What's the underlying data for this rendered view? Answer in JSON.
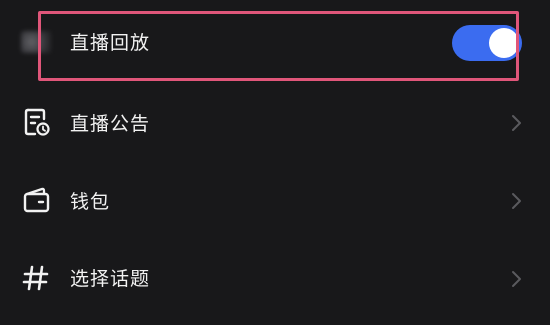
{
  "settings": {
    "items": [
      {
        "label": "直播回放",
        "icon": "avatar-icon",
        "control": "toggle",
        "on": true
      },
      {
        "label": "直播公告",
        "icon": "notice-icon",
        "control": "chevron"
      },
      {
        "label": "钱包",
        "icon": "wallet-icon",
        "control": "chevron"
      },
      {
        "label": "选择话题",
        "icon": "hashtag-icon",
        "control": "chevron"
      }
    ]
  },
  "colors": {
    "background": "#18181a",
    "text": "#f2f2f2",
    "toggle_on": "#3b6cf0",
    "highlight": "#e0567a",
    "chevron": "#5a5a5e"
  }
}
